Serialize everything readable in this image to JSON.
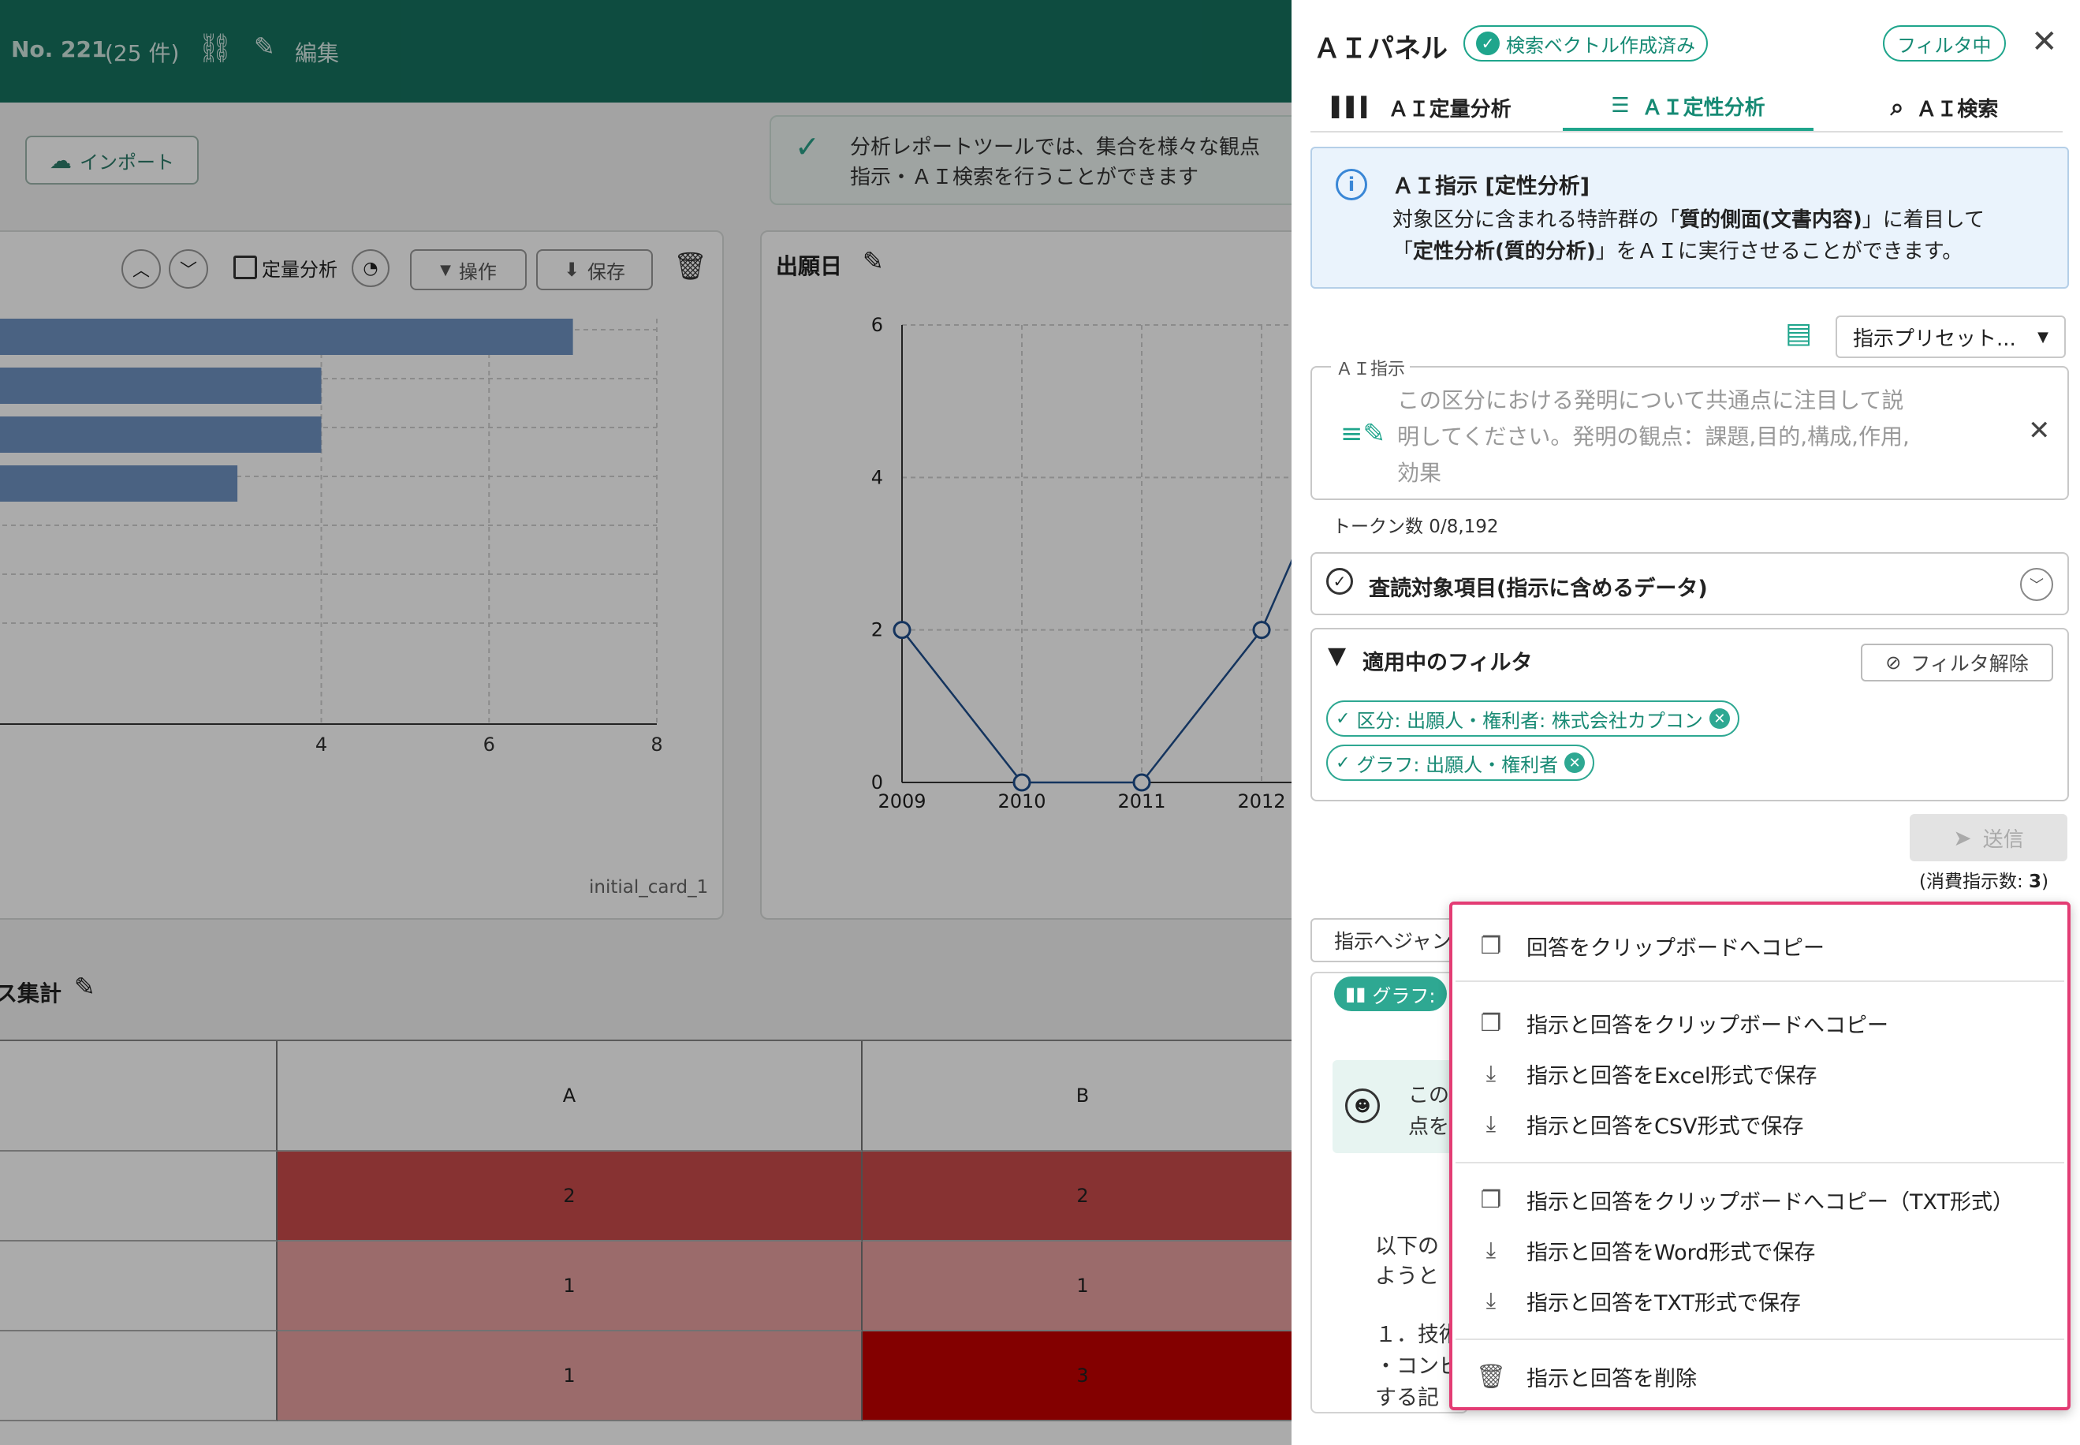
{
  "header": {
    "record_no": "No. 221",
    "count": "(25 件)",
    "edit_label": "編集"
  },
  "toolbar": {
    "import_label": "インポート",
    "notice_line1": "分析レポートツールでは、集合を様々な観点",
    "notice_line2": "指示・ＡＩ検索を行うことができます"
  },
  "left_card": {
    "quant_label": "定量分析",
    "ops_label": "操作",
    "save_label": "保存",
    "card_id": "initial_card_1",
    "x_ticks": [
      "4",
      "6",
      "8"
    ]
  },
  "filing_card": {
    "title": "出願日",
    "y_ticks": [
      "6",
      "4",
      "2",
      "0"
    ],
    "x_ticks": [
      "2009",
      "2010",
      "2011",
      "2012"
    ]
  },
  "cross_table": {
    "title": "ス集計",
    "columns": [
      "A",
      "B"
    ],
    "rows": [
      [
        "2",
        "2"
      ],
      [
        "1",
        "1"
      ],
      [
        "1",
        "3"
      ]
    ]
  },
  "chart_data": [
    {
      "type": "bar",
      "orientation": "horizontal",
      "values": [
        7,
        4,
        4,
        3
      ],
      "xlim": [
        0,
        8
      ],
      "x_ticks": [
        4,
        6,
        8
      ]
    },
    {
      "type": "line",
      "title": "出願日",
      "x": [
        "2009",
        "2010",
        "2011",
        "2012"
      ],
      "values": [
        2,
        0,
        0,
        2
      ],
      "ylim": [
        0,
        6
      ],
      "y_ticks": [
        0,
        2,
        4,
        6
      ]
    }
  ],
  "panel": {
    "title": "ＡＩパネル",
    "vector_badge": "検索ベクトル作成済み",
    "filter_badge": "フィルタ中",
    "tabs": [
      {
        "label": "ＡＩ定量分析"
      },
      {
        "label": "ＡＩ定性分析"
      },
      {
        "label": "ＡＩ検索"
      }
    ],
    "info_title": "ＡＩ指示 [定性分析]",
    "info_line1_a": "対象区分に含まれる特許群の「",
    "info_line1_b": "質的側面(文書内容)",
    "info_line1_c": "」に着目して",
    "info_line2_a": "「",
    "info_line2_b": "定性分析(質的分析)",
    "info_line2_c": "」をＡＩに実行させることができます。",
    "preset_label": "指示プリセット...",
    "instruction_label": "ＡＩ指示",
    "instruction_placeholder_1": "この区分における発明について共通点に注目して説",
    "instruction_placeholder_2": "明してください。発明の観点：課題,目的,構成,作用,",
    "instruction_placeholder_3": "効果",
    "token_count": "トークン数 0/8,192",
    "review_items_label": "査読対象項目(指示に含めるデータ)",
    "filter_title": "適用中のフィルタ",
    "filter_clear": "フィルタ解除",
    "filter_chips": [
      "区分: 出願人・権利者: 株式会社カプコン",
      "グラフ: 出願人・権利者"
    ],
    "send_label": "送信",
    "consumption_a": "(消費指示数: ",
    "consumption_b": "3",
    "consumption_c": ")",
    "jump_label": "指示へジャン",
    "graph_tag": "グラフ:",
    "partial_1": "この",
    "partial_2": "点を",
    "partial_3": "以下の",
    "partial_4": "ようと",
    "partial_5": "１．技術",
    "partial_6": "・コンビ",
    "partial_7": "する記"
  },
  "context_menu": {
    "items": [
      {
        "label": "回答をクリップボードへコピー",
        "icon": "copy-icon"
      },
      {
        "label": "指示と回答をクリップボードへコピー",
        "icon": "copy-icon"
      },
      {
        "label": "指示と回答をExcel形式で保存",
        "icon": "download-icon"
      },
      {
        "label": "指示と回答をCSV形式で保存",
        "icon": "download-icon"
      },
      {
        "label": "指示と回答をクリップボードへコピー（TXT形式）",
        "icon": "copy-icon"
      },
      {
        "label": "指示と回答をWord形式で保存",
        "icon": "download-icon"
      },
      {
        "label": "指示と回答をTXT形式で保存",
        "icon": "download-icon"
      },
      {
        "label": "指示と回答を削除",
        "icon": "trash-icon"
      }
    ]
  },
  "colors": {
    "brand_green": "#15725f",
    "accent_teal": "#1fa58c",
    "menu_highlight": "#e33c74",
    "bar_blue": "#6f93c2"
  }
}
